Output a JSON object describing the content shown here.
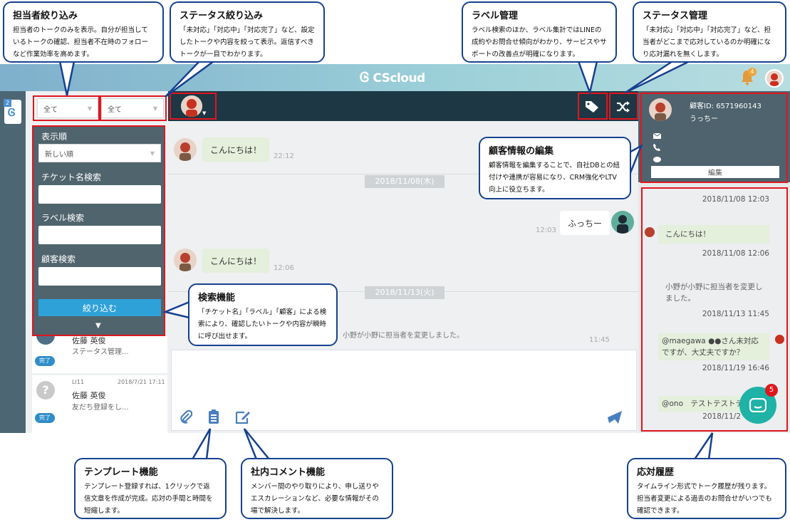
{
  "app": {
    "logo": "CScloud",
    "bell_badge": "4",
    "chat_badge": "5"
  },
  "rail": {
    "badge": "2"
  },
  "filters": {
    "assignee_value": "全て",
    "status_value": "全て"
  },
  "panel": {
    "sort_label": "表示順",
    "sort_value": "新しい順",
    "ticket_label": "チケット名検索",
    "label_label": "ラベル検索",
    "customer_label": "顧客検索",
    "button": "絞り込む"
  },
  "tickets": [
    {
      "name": "佐藤 英俊",
      "sub": "ステータス管理...",
      "status": "完了"
    },
    {
      "id": "LI11",
      "date": "2018/7/21 17:11",
      "name": "佐藤 英俊",
      "sub": "友だち登録をし...",
      "status": "完了"
    }
  ],
  "chat": {
    "msg1": "こんにちは！",
    "msg1_time": "22:12",
    "date1": "2018/11/08(木)",
    "msg2": "ふっちー",
    "msg2_time": "12:03",
    "msg3": "こんにちは！",
    "msg3_time": "12:06",
    "date2": "2018/11/13(火)",
    "sys": "小野が小野に担当者を変更しました。",
    "sys_time": "11:45"
  },
  "customer": {
    "id": "顧客ID: 6571960143",
    "name": "うっちー",
    "edit": "編集"
  },
  "timeline": [
    {
      "time": "2018/11/08 12:03"
    },
    {
      "text": "こんにちは！",
      "time": "2018/11/08 12:06"
    },
    {
      "text": "小野が小野に担当者を変更しました。",
      "time": "2018/11/13 11:45"
    },
    {
      "text": "@maegawa ●●さん未対応ですが、大丈夫ですか？",
      "time": "2018/11/19 16:46"
    },
    {
      "text": "@ono　テストテストテ",
      "time": "2018/11/2"
    }
  ],
  "callouts": {
    "assignee": {
      "title": "担当者絞り込み",
      "body": "担当者のトークのみを表示。自分が担当しているトークの確認、担当者不在時のフォローなど作業効率を高めます。"
    },
    "status": {
      "title": "ステータス絞り込み",
      "body": "「未対応」「対応中」「対応完了」など、設定したトークや内容を絞って表示。返信すべきトークが一目でわかります。"
    },
    "label": {
      "title": "ラベル管理",
      "body": "ラベル検索のほか、ラベル集計ではLINEの成約やお問合せ傾向がわかり、サービスやサポートの改善点が明確になります。"
    },
    "statusmgmt": {
      "title": "ステータス管理",
      "body": "「未対応」「対応中」「対応完了」など、担当者がどこまで応対しているのか明確になり応対漏れを無くします。"
    },
    "custedit": {
      "title": "顧客情報の編集",
      "body": "顧客情報を編集することで、自社DBとの紐付けや連携が容易になり、CRM強化やLTV向上に役立ちます。"
    },
    "search": {
      "title": "検索機能",
      "body": "「チケット名」「ラベル」「顧客」による検索により、確認したいトークや内容が瞬時に呼び出せます。"
    },
    "template": {
      "title": "テンプレート機能",
      "body": "テンプレート登録すれば、1クリックで返信文章を作成が完成。応対の手間と時間を短縮します。"
    },
    "comment": {
      "title": "社内コメント機能",
      "body": "メンバー間のやり取りにより、申し送りやエスカレーションなど、必要な情報がその場で解決します。"
    },
    "history": {
      "title": "応対履歴",
      "body": "タイムライン形式でトーク履歴が残ります。担当者変更による過去のお問合せがいつでも確認できます。"
    }
  }
}
